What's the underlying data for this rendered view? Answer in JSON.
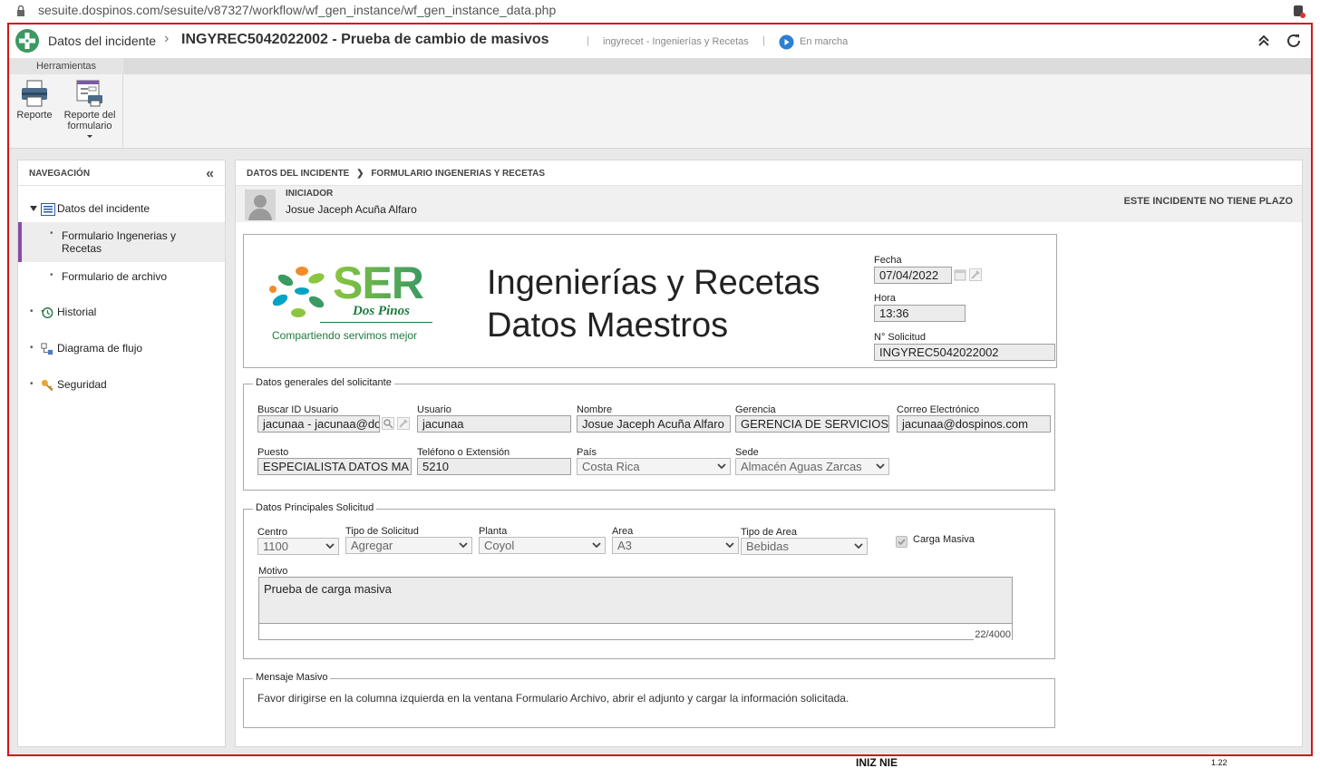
{
  "browser": {
    "url": "sesuite.dospinos.com/sesuite/v87327/workflow/wf_gen_instance/wf_gen_instance_data.php"
  },
  "header": {
    "breadcrumb_root": "Datos del incidente",
    "separator": "›",
    "title": "INGYREC5042022002 - Prueba de cambio de masivos",
    "process": "ingyrecet - Ingenierías y Recetas",
    "status": "En marcha",
    "status_color": "#2d7fd1"
  },
  "ribbon": {
    "tab": "Herramientas",
    "buttons": [
      {
        "label": "Reporte",
        "icon": "printer-icon"
      },
      {
        "label_line1": "Reporte del",
        "label_line2": "formulario",
        "icon": "form-report-icon"
      }
    ]
  },
  "navigation": {
    "title": "NAVEGACIÓN",
    "items": [
      {
        "label": "Datos del incidente",
        "icon": "list-icon"
      },
      {
        "label_line1": "Formulario Ingenerias y",
        "label_line2": "Recetas"
      },
      {
        "label": "Formulario de archivo"
      },
      {
        "label": "Historial",
        "icon": "history-icon"
      },
      {
        "label": "Diagrama de flujo",
        "icon": "flow-diagram-icon"
      },
      {
        "label": "Seguridad",
        "icon": "key-icon"
      }
    ],
    "active_color": "#8a4aa8"
  },
  "content": {
    "breadcrumb_part1": "DATOS DEL INCIDENTE",
    "breadcrumb_part2": "FORMULARIO INGENERIAS Y RECETAS",
    "initiator_label": "INICIADOR",
    "initiator_name": "Josue Jaceph Acuña Alfaro",
    "deadline_note": "ESTE INCIDENTE NO TIENE PLAZO"
  },
  "form": {
    "logo_main": "SER",
    "logo_sub": "Dos Pinos",
    "logo_tagline": "Compartiendo servimos mejor",
    "title_line1": "Ingenierías y Recetas",
    "title_line2": "Datos Maestros",
    "fecha_label": "Fecha",
    "fecha": "07/04/2022",
    "hora_label": "Hora",
    "hora": "13:36",
    "solicitud_label": "N° Solicitud",
    "solicitud": "INGYREC5042022002",
    "section1_title": "Datos generales del solicitante",
    "buscar_label": "Buscar ID Usuario",
    "buscar_value": "jacunaa - jacunaa@dos",
    "usuario_label": "Usuario",
    "usuario_value": "jacunaa",
    "nombre_label": "Nombre",
    "nombre_value": "Josue Jaceph Acuña Alfaro",
    "gerencia_label": "Gerencia",
    "gerencia_value": "GERENCIA DE SERVICIOS",
    "correo_label": "Correo Electrónico",
    "correo_value": "jacunaa@dospinos.com",
    "puesto_label": "Puesto",
    "puesto_value": "ESPECIALISTA DATOS MA",
    "telefono_label": "Teléfono o Extensión",
    "telefono_value": "5210",
    "pais_label": "País",
    "pais_value": "Costa Rica",
    "sede_label": "Sede",
    "sede_value": "Almacén Aguas Zarcas",
    "section2_title": "Datos Principales Solicitud",
    "centro_label": "Centro",
    "centro_value": "1100",
    "tipo_solicitud_label": "Tipo de Solicitud",
    "tipo_solicitud_value": "Agregar",
    "planta_label": "Planta",
    "planta_value": "Coyol",
    "area_label": "Area",
    "area_value": "A3",
    "tipo_area_label": "Tipo de Area",
    "tipo_area_value": "Bebidas",
    "carga_masiva_label": "Carga Masiva",
    "carga_masiva_checked": true,
    "motivo_label": "Motivo",
    "motivo_value": "Prueba de carga masiva",
    "motivo_count": "22/4000",
    "section3_title": "Mensaje Masivo",
    "mensaje": "Favor dirigirse en la columna izquierda en la ventana Formulario Archivo, abrir el adjunto y cargar la información solicitada."
  },
  "footer_fragment": {
    "text": "INIZ NIE",
    "number": "1.22"
  }
}
